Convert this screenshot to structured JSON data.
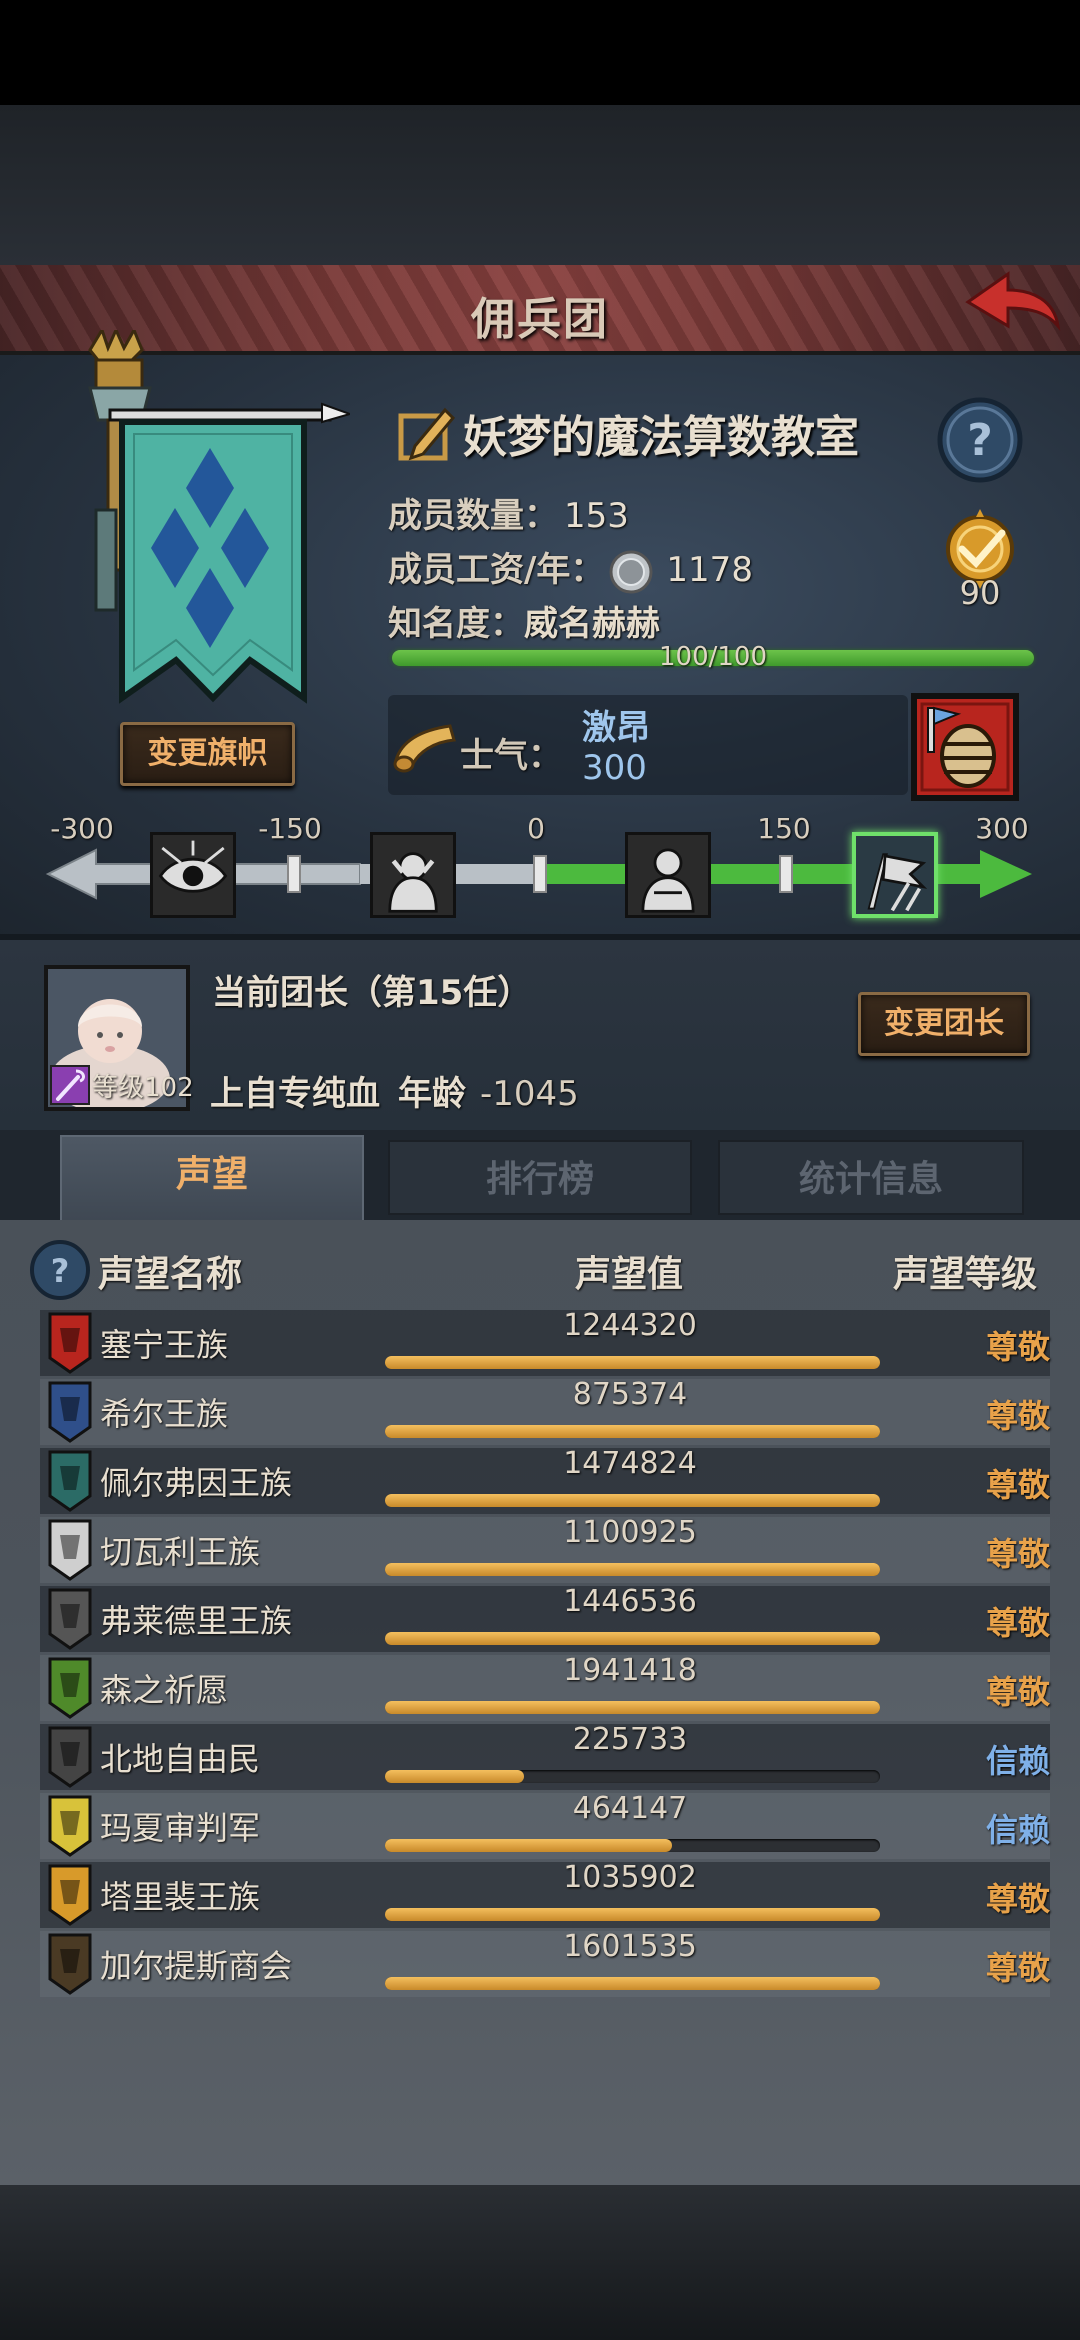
{
  "header": {
    "title": "佣兵团"
  },
  "guild": {
    "name": "妖梦的魔法算数教室",
    "members_label": "成员数量：",
    "members_value": "153",
    "wage_label": "成员工资/年：",
    "wage_value": "1178",
    "fame_label": "知名度：",
    "fame_value": "威名赫赫",
    "fame_bar_text": "100/100",
    "fame_fraction": 1.0,
    "achievement_count": "90",
    "change_flag_label": "变更旗帜"
  },
  "morale": {
    "label": "士气：",
    "state": "激昂",
    "value": "300",
    "ticks": [
      "-300",
      "-150",
      "0",
      "150",
      "300"
    ],
    "active_stage": 3
  },
  "leader": {
    "title": "当前团长（第15任）",
    "level_label": "等级102",
    "name": "上自专纯血",
    "age_label": "年龄",
    "age_value": "-1045",
    "change_label": "变更团长"
  },
  "tabs": [
    {
      "label": "声望",
      "active": true
    },
    {
      "label": "排行榜",
      "active": false
    },
    {
      "label": "统计信息",
      "active": false
    }
  ],
  "reputation": {
    "headers": {
      "name": "声望名称",
      "value": "声望值",
      "level": "声望等级"
    },
    "rows": [
      {
        "name": "塞宁王族",
        "value": "1244320",
        "fill": 1.0,
        "level": "尊敬",
        "icon": "red-tower-crest-icon"
      },
      {
        "name": "希尔王族",
        "value": "875374",
        "fill": 1.0,
        "level": "尊敬",
        "icon": "blue-helmet-crest-icon"
      },
      {
        "name": "佩尔弗因王族",
        "value": "1474824",
        "fill": 1.0,
        "level": "尊敬",
        "icon": "teal-moon-crest-icon"
      },
      {
        "name": "切瓦利王族",
        "value": "1100925",
        "fill": 1.0,
        "level": "尊敬",
        "icon": "scales-crest-icon"
      },
      {
        "name": "弗莱德里王族",
        "value": "1446536",
        "fill": 1.0,
        "level": "尊敬",
        "icon": "wolf-crest-icon"
      },
      {
        "name": "森之祈愿",
        "value": "1941418",
        "fill": 1.0,
        "level": "尊敬",
        "icon": "tree-crest-icon"
      },
      {
        "name": "北地自由民",
        "value": "225733",
        "fill": 0.28,
        "level": "信赖",
        "icon": "axe-crest-icon"
      },
      {
        "name": "玛夏审判军",
        "value": "464147",
        "fill": 0.58,
        "level": "信赖",
        "icon": "yellow-sword-crest-icon"
      },
      {
        "name": "塔里裴王族",
        "value": "1035902",
        "fill": 1.0,
        "level": "尊敬",
        "icon": "gold-flame-crest-icon"
      },
      {
        "name": "加尔提斯商会",
        "value": "1601535",
        "fill": 1.0,
        "level": "尊敬",
        "icon": "chest-crest-icon"
      }
    ]
  },
  "colors": {
    "level_respect": "#e8a24a",
    "level_trust": "#7fb0e8",
    "accent": "#f0b06a",
    "fame_bar": "#5cb83e",
    "morale_text": "#9fc6ec"
  }
}
